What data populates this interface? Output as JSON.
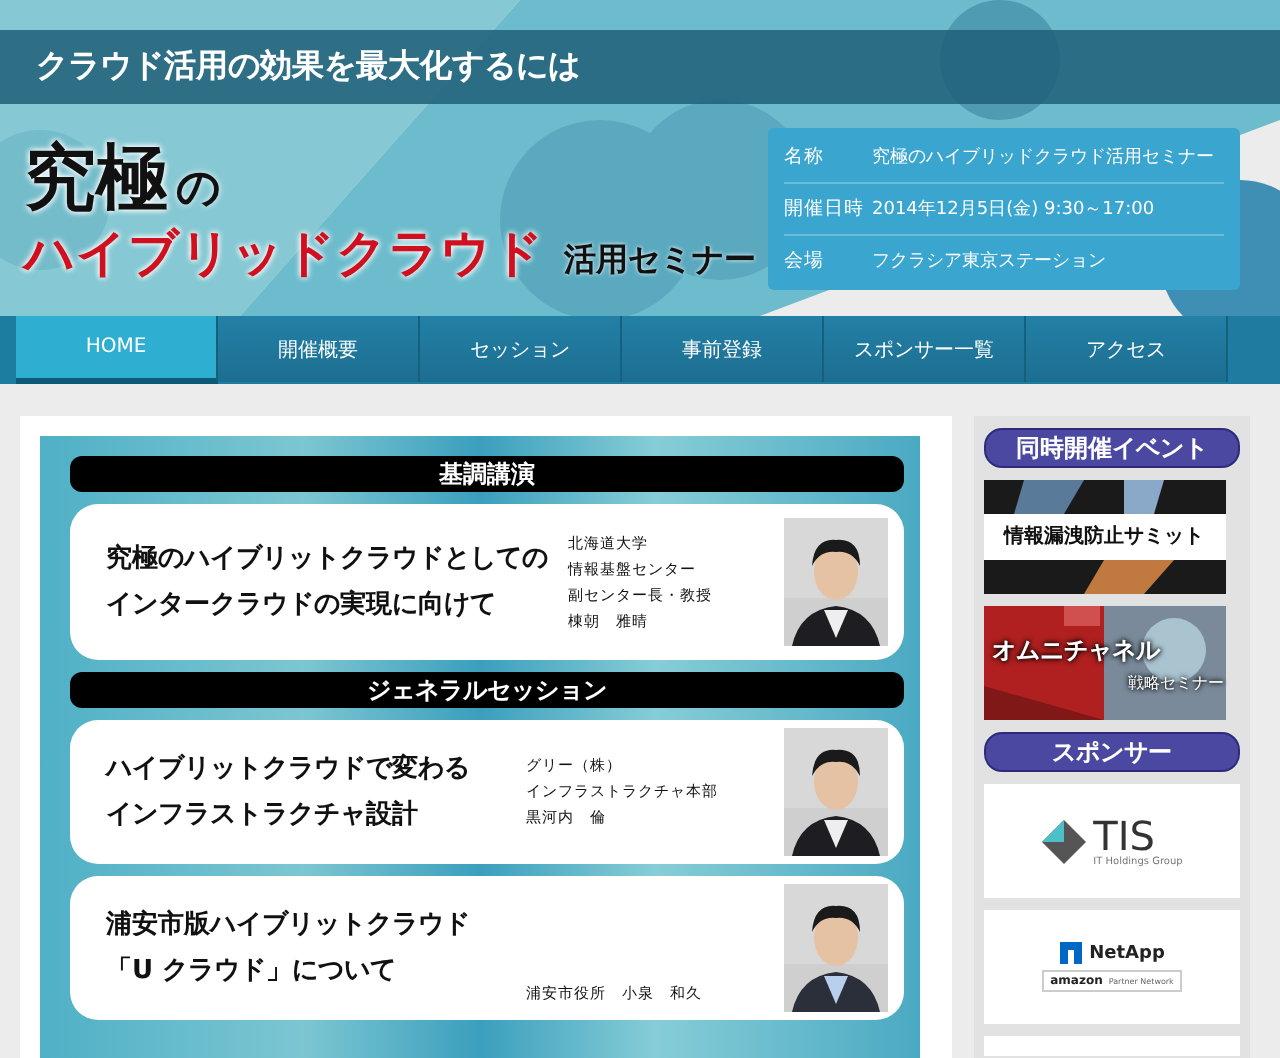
{
  "header": {
    "tagline": "クラウド活用の効果を最大化するには",
    "logo": {
      "line1": "究極",
      "particle": "の",
      "line2": "ハイブリッドクラウド",
      "suffix": "活用セミナー"
    },
    "info": [
      {
        "label": "名称",
        "value": "究極のハイブリッドクラウド活用セミナー"
      },
      {
        "label": "開催日時",
        "value": "2014年12月5日(金) 9:30～17:00"
      },
      {
        "label": "会場",
        "value": "フクラシア東京ステーション"
      }
    ]
  },
  "nav": [
    {
      "label": "HOME",
      "selected": true
    },
    {
      "label": "開催概要",
      "selected": false
    },
    {
      "label": "セッション",
      "selected": false
    },
    {
      "label": "事前登録",
      "selected": false
    },
    {
      "label": "スポンサー一覧",
      "selected": false
    },
    {
      "label": "アクセス",
      "selected": false
    }
  ],
  "sections": [
    {
      "title": "基調講演",
      "sessions": [
        {
          "title": [
            "究極のハイブリットクラウドとしての",
            "インタークラウドの実現に向けて"
          ],
          "speaker": [
            "北海道大学",
            "情報基盤センター",
            "副センター長・教授",
            "棟朝　雅晴"
          ]
        }
      ]
    },
    {
      "title": "ジェネラルセッション",
      "sessions": [
        {
          "title": [
            "ハイブリットクラウドで変わる",
            "インフラストラクチャ設計"
          ],
          "speaker": [
            "グリー（株）",
            "インフラストラクチャ本部",
            "黒河内　倫"
          ]
        },
        {
          "title": [
            "浦安市版ハイブリットクラウド",
            "「U クラウド」について"
          ],
          "speaker": [
            "浦安市役所　小泉　和久"
          ]
        }
      ]
    }
  ],
  "sidebar": {
    "events_heading": "同時開催イベント",
    "events": [
      {
        "kind": "light",
        "title": "情報漏洩防止サミット"
      },
      {
        "kind": "red",
        "title": "オムニチャネル",
        "subtitle": "戦略セミナー"
      }
    ],
    "sponsors_heading": "スポンサー",
    "sponsors": [
      {
        "kind": "tis",
        "name": "TIS",
        "tagline": "IT Holdings Group"
      },
      {
        "kind": "netapp",
        "name": "NetApp",
        "partner": "amazon",
        "partner_note": "Partner Network"
      },
      {
        "kind": "empty"
      }
    ]
  }
}
